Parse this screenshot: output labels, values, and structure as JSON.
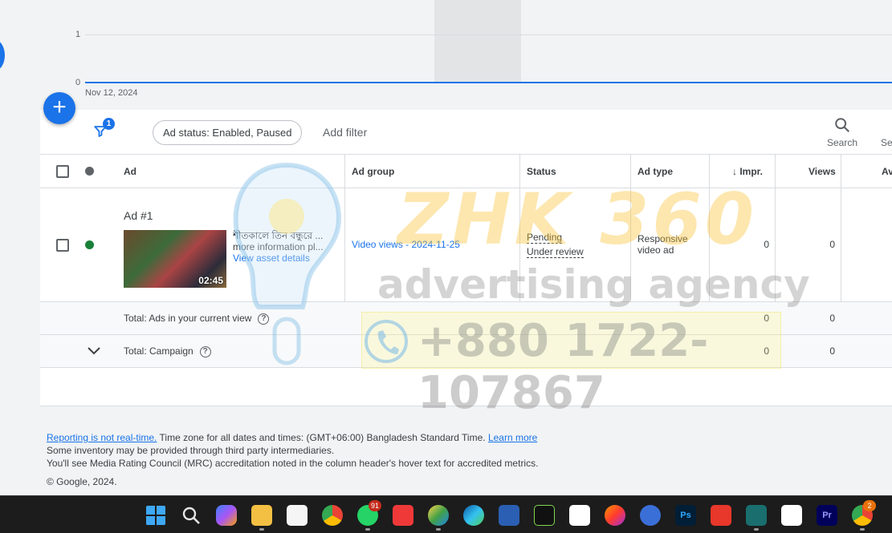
{
  "chart": {
    "y_labels": [
      "1",
      "0"
    ],
    "date_label": "Nov 12, 2024"
  },
  "filters": {
    "badge_count": "1",
    "chip_label": "Ad status: Enabled, Paused",
    "add_filter_label": "Add filter"
  },
  "toolbar": {
    "search_label": "Search",
    "segment_label_partial": "Se"
  },
  "table": {
    "headers": {
      "ad": "Ad",
      "ad_group": "Ad group",
      "status": "Status",
      "ad_type": "Ad type",
      "impr": "Impr.",
      "views": "Views",
      "avg_cpv": "Avg. CP"
    },
    "rows": [
      {
        "ad_name": "Ad #1",
        "headline": "শীতকালে তিন বন্ধুরে ...",
        "description": "more information pl...",
        "asset_link": "View asset details",
        "duration": "02:45",
        "ad_group": "Video views - 2024-11-25",
        "status_line1": "Pending",
        "status_line2": "Under review",
        "ad_type_line1": "Responsive",
        "ad_type_line2": "video ad",
        "impr": "0",
        "views": "0",
        "enabled_color": "#188038"
      }
    ],
    "totals": [
      {
        "label": "Total: Ads in your current view",
        "impr": "0",
        "views": "0"
      },
      {
        "label": "Total: Campaign",
        "impr": "0",
        "views": "0"
      }
    ]
  },
  "watermark": {
    "brand": "ZHK 360",
    "agency": "advertising agency",
    "phone": "+880 1722-107867"
  },
  "footer": {
    "reporting_link": "Reporting is not real-time.",
    "timezone_text": "Time zone for all dates and times: (GMT+06:00) Bangladesh Standard Time.",
    "learn_more": "Learn more",
    "inventory_text": "Some inventory may be provided through third party intermediaries.",
    "mrc_text": "You'll see Media Rating Council (MRC) accreditation noted in the column header's hover text for accredited metrics.",
    "copyright": "© Google, 2024."
  },
  "taskbar": {
    "whatsapp_badge": "91",
    "chrome_badge": "2",
    "photoshop_label": "Ps",
    "premiere_label": "Pr"
  },
  "colors": {
    "accent": "#1a73e8",
    "taskbar": "#1c1c1c"
  }
}
